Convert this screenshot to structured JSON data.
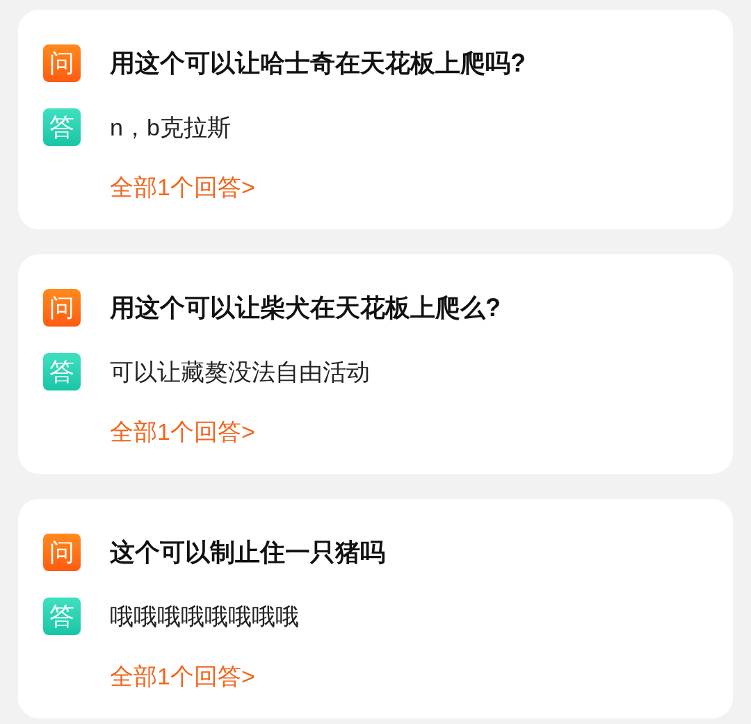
{
  "items": [
    {
      "question_badge": "问",
      "question": "用这个可以让哈士奇在天花板上爬吗?",
      "answer_badge": "答",
      "answer": "n，b克拉斯",
      "more_link": "全部1个回答>"
    },
    {
      "question_badge": "问",
      "question": "用这个可以让柴犬在天花板上爬么?",
      "answer_badge": "答",
      "answer": "可以让藏獒没法自由活动",
      "more_link": "全部1个回答>"
    },
    {
      "question_badge": "问",
      "question": "这个可以制止住一只猪吗",
      "answer_badge": "答",
      "answer": "哦哦哦哦哦哦哦哦",
      "more_link": "全部1个回答>"
    }
  ]
}
